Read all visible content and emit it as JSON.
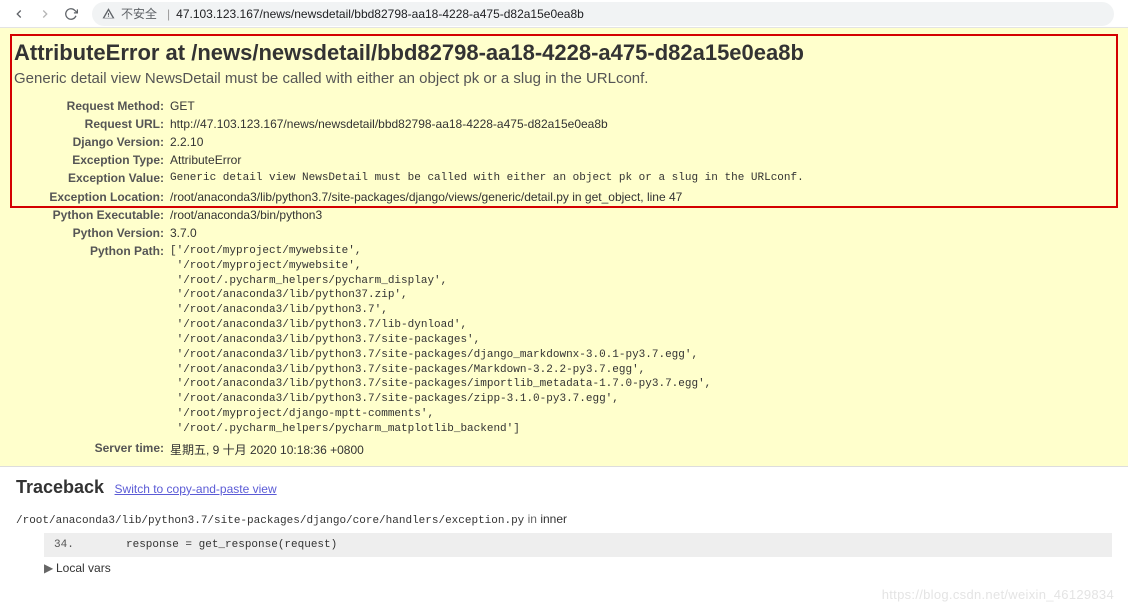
{
  "browser": {
    "insecure_label": "不安全",
    "url_host_path": "47.103.123.167/news/newsdetail/bbd82798-aa18-4228-a475-d82a15e0ea8b"
  },
  "error": {
    "title": "AttributeError at /news/newsdetail/bbd82798-aa18-4228-a475-d82a15e0ea8b",
    "subtitle": "Generic detail view NewsDetail must be called with either an object pk or a slug in the URLconf.",
    "meta": {
      "request_method_label": "Request Method:",
      "request_method": "GET",
      "request_url_label": "Request URL:",
      "request_url": "http://47.103.123.167/news/newsdetail/bbd82798-aa18-4228-a475-d82a15e0ea8b",
      "django_version_label": "Django Version:",
      "django_version": "2.2.10",
      "exception_type_label": "Exception Type:",
      "exception_type": "AttributeError",
      "exception_value_label": "Exception Value:",
      "exception_value": "Generic detail view NewsDetail must be called with either an object pk or a slug in the URLconf.",
      "exception_location_label": "Exception Location:",
      "exception_location": "/root/anaconda3/lib/python3.7/site-packages/django/views/generic/detail.py in get_object, line 47",
      "python_executable_label": "Python Executable:",
      "python_executable": "/root/anaconda3/bin/python3",
      "python_version_label": "Python Version:",
      "python_version": "3.7.0",
      "python_path_label": "Python Path:",
      "python_path": "['/root/myproject/mywebsite',\n '/root/myproject/mywebsite',\n '/root/.pycharm_helpers/pycharm_display',\n '/root/anaconda3/lib/python37.zip',\n '/root/anaconda3/lib/python3.7',\n '/root/anaconda3/lib/python3.7/lib-dynload',\n '/root/anaconda3/lib/python3.7/site-packages',\n '/root/anaconda3/lib/python3.7/site-packages/django_markdownx-3.0.1-py3.7.egg',\n '/root/anaconda3/lib/python3.7/site-packages/Markdown-3.2.2-py3.7.egg',\n '/root/anaconda3/lib/python3.7/site-packages/importlib_metadata-1.7.0-py3.7.egg',\n '/root/anaconda3/lib/python3.7/site-packages/zipp-3.1.0-py3.7.egg',\n '/root/myproject/django-mptt-comments',\n '/root/.pycharm_helpers/pycharm_matplotlib_backend']",
      "server_time_label": "Server time:",
      "server_time": "星期五, 9 十月 2020 10:18:36 +0800"
    }
  },
  "traceback": {
    "heading": "Traceback",
    "switch_link": "Switch to copy-and-paste view",
    "frame1": {
      "file": "/root/anaconda3/lib/python3.7/site-packages/django/core/handlers/exception.py",
      "in_word": "in",
      "func": "inner",
      "lineno": "34.",
      "code": "response = get_response(request)",
      "local_vars": "Local vars"
    }
  },
  "watermark": "https://blog.csdn.net/weixin_46129834"
}
